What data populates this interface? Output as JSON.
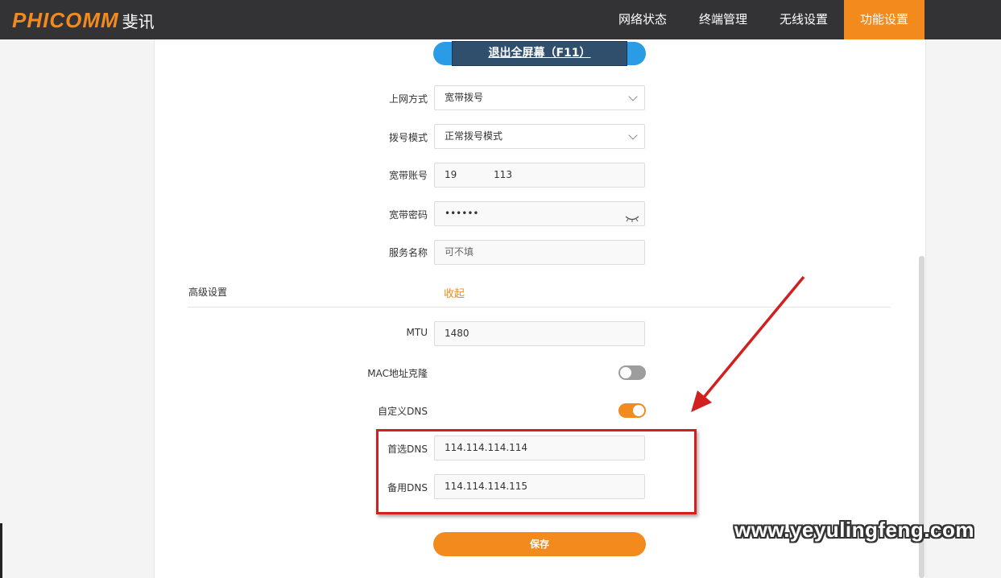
{
  "header": {
    "logo_text": "PHICOMM",
    "logo_cn": "斐讯",
    "nav": [
      {
        "label": "网络状态"
      },
      {
        "label": "终端管理"
      },
      {
        "label": "无线设置"
      },
      {
        "label": "功能设置",
        "active": true
      }
    ]
  },
  "fullscreen_button": "退出全屏幕（F11）",
  "form": {
    "connection_type": {
      "label": "上网方式",
      "value": "宽带拨号"
    },
    "dial_mode": {
      "label": "拨号模式",
      "value": "正常拨号模式"
    },
    "account": {
      "label": "宽带账号",
      "value": "19            113"
    },
    "password": {
      "label": "宽带密码",
      "value": "••••••"
    },
    "service_name": {
      "label": "服务名称",
      "placeholder": "可不填"
    }
  },
  "advanced": {
    "label": "高级设置",
    "collapse_link": "收起",
    "mtu": {
      "label": "MTU",
      "value": "1480"
    },
    "mac_clone": {
      "label": "MAC地址克隆",
      "enabled": false
    },
    "custom_dns": {
      "label": "自定义DNS",
      "enabled": true
    },
    "primary_dns": {
      "label": "首选DNS",
      "value": "114.114.114.114"
    },
    "secondary_dns": {
      "label": "备用DNS",
      "value": "114.114.114.115"
    }
  },
  "save_label": "保存",
  "watermark": "www.yeyulingfeng.com",
  "colors": {
    "accent": "#f28a1e",
    "topbar": "#333336",
    "annotation": "#d2201f"
  }
}
